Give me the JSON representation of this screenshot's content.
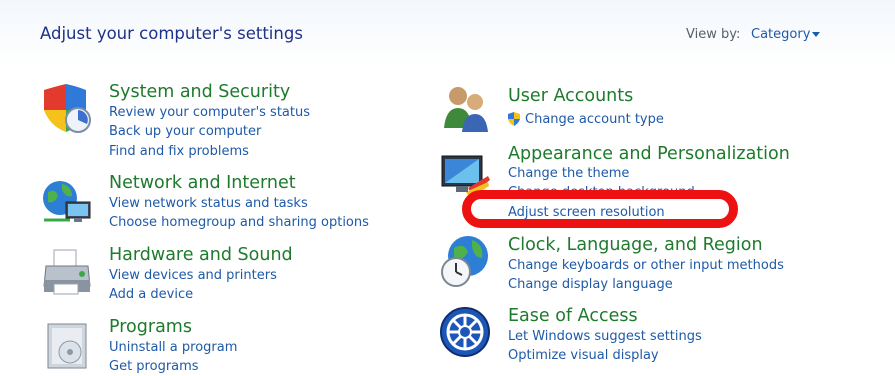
{
  "header": {
    "title": "Adjust your computer's settings",
    "view_by_label": "View by:",
    "view_by_value": "Category"
  },
  "categories": [
    {
      "icon": "shield-icon",
      "title": "System and Security",
      "links": [
        "Review your computer's status",
        "Back up your computer",
        "Find and fix problems"
      ]
    },
    {
      "icon": "network-icon",
      "title": "Network and Internet",
      "links": [
        "View network status and tasks",
        "Choose homegroup and sharing options"
      ]
    },
    {
      "icon": "printer-icon",
      "title": "Hardware and Sound",
      "links": [
        "View devices and printers",
        "Add a device"
      ]
    },
    {
      "icon": "programs-icon",
      "title": "Programs",
      "links": [
        "Uninstall a program",
        "Get programs"
      ]
    },
    {
      "icon": "users-icon",
      "title": "User Accounts",
      "links": [
        "Change account type"
      ]
    },
    {
      "icon": "monitor-icon",
      "title": "Appearance and Personalization",
      "links": [
        "Change the theme",
        "Change desktop background",
        "Adjust screen resolution"
      ]
    },
    {
      "icon": "globe-clock-icon",
      "title": "Clock, Language, and Region",
      "links": [
        "Change keyboards or other input methods",
        "Change display language"
      ]
    },
    {
      "icon": "ease-of-access-icon",
      "title": "Ease of Access",
      "links": [
        "Let Windows suggest settings",
        "Optimize visual display"
      ]
    }
  ],
  "annotation": {
    "color": "#ee1111",
    "target": "Adjust screen resolution"
  },
  "colors": {
    "title_green": "#1e7a2c",
    "link_blue": "#1e5aa8",
    "header_blue": "#1e3287"
  }
}
